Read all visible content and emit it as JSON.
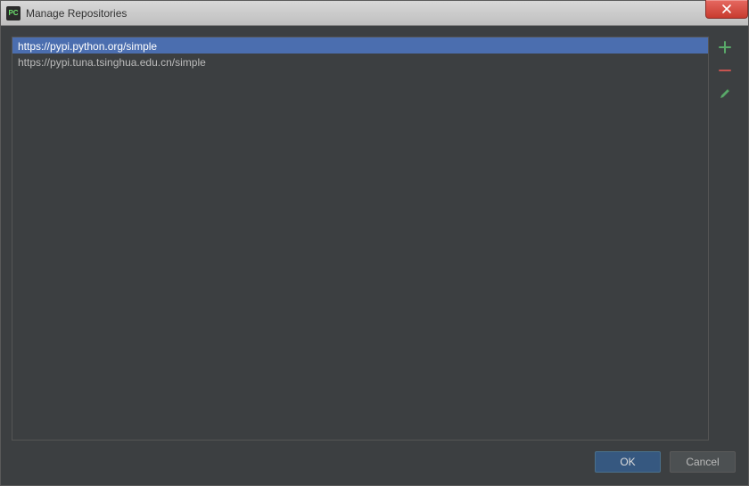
{
  "window": {
    "title": "Manage Repositories",
    "app_icon_text": "PC"
  },
  "repositories": [
    {
      "url": "https://pypi.python.org/simple",
      "selected": true
    },
    {
      "url": "https://pypi.tuna.tsinghua.edu.cn/simple",
      "selected": false
    }
  ],
  "buttons": {
    "ok": "OK",
    "cancel": "Cancel"
  }
}
